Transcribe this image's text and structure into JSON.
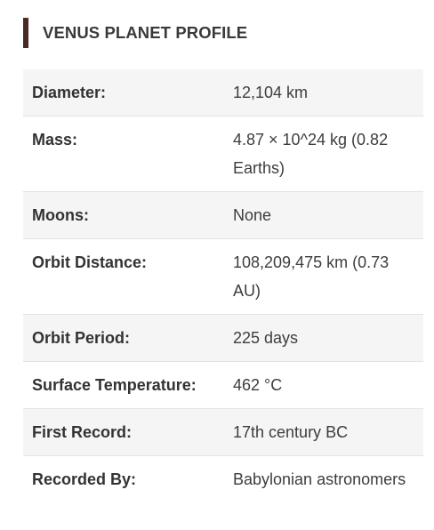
{
  "header": {
    "title": "VENUS PLANET PROFILE",
    "accent_color": "#4a2a25"
  },
  "rows": [
    {
      "label": "Diameter:",
      "value": "12,104 km"
    },
    {
      "label": "Mass:",
      "value": "4.87 × 10^24 kg (0.82 Earths)"
    },
    {
      "label": "Moons:",
      "value": "None"
    },
    {
      "label": "Orbit Distance:",
      "value": "108,209,475 km (0.73 AU)"
    },
    {
      "label": "Orbit Period:",
      "value": "225 days"
    },
    {
      "label": "Surface Temperature:",
      "value": "462 °C"
    },
    {
      "label": "First Record:",
      "value": "17th century BC"
    },
    {
      "label": "Recorded By:",
      "value": "Babylonian astronomers"
    }
  ]
}
